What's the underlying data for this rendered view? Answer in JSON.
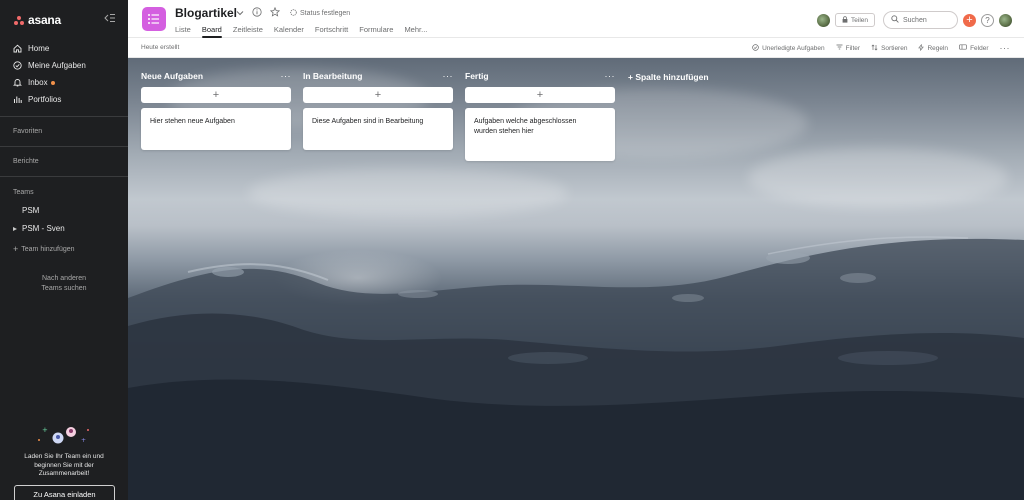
{
  "sidebar": {
    "logo_text": "asana",
    "nav": [
      {
        "label": "Home",
        "icon": "home-icon"
      },
      {
        "label": "Meine Aufgaben",
        "icon": "check-circle-icon"
      },
      {
        "label": "Inbox",
        "icon": "bell-icon"
      },
      {
        "label": "Portfolios",
        "icon": "bar-chart-icon"
      }
    ],
    "favorites_label": "Favoriten",
    "reports_label": "Berichte",
    "teams_label": "Teams",
    "teams": [
      {
        "label": "PSM"
      },
      {
        "label": "PSM - Sven"
      }
    ],
    "add_team_label": "Team hinzufügen",
    "browse_teams_label": "Nach anderen Teams suchen",
    "invite_text": "Laden Sie Ihr Team ein und beginnen Sie mit der Zusammenarbeit!",
    "invite_button": "Zu Asana einladen"
  },
  "header": {
    "project_title": "Blogartikel",
    "status_label": "Status festlegen",
    "tabs": [
      {
        "label": "Liste",
        "active": false
      },
      {
        "label": "Board",
        "active": true
      },
      {
        "label": "Zeitleiste",
        "active": false
      },
      {
        "label": "Kalender",
        "active": false
      },
      {
        "label": "Fortschritt",
        "active": false
      },
      {
        "label": "Formulare",
        "active": false
      },
      {
        "label": "Mehr...",
        "active": false
      }
    ],
    "share_label": "Teilen",
    "search_placeholder": "Suchen",
    "help_label": "?"
  },
  "toolbar": {
    "last_created": "Heute erstellt",
    "incomplete_tasks": "Unerledigte Aufgaben",
    "filter": "Filter",
    "sort": "Sortieren",
    "rules": "Regeln",
    "fields": "Felder"
  },
  "board": {
    "columns": [
      {
        "title": "Neue Aufgaben",
        "cards": [
          "Hier stehen neue Aufgaben"
        ]
      },
      {
        "title": "In Bearbeitung",
        "cards": [
          "Diese Aufgaben sind in Bearbeitung"
        ]
      },
      {
        "title": "Fertig",
        "cards": [
          "Aufgaben welche abgeschlossen wurden stehen hier"
        ]
      }
    ],
    "add_section_label": "+ Spalte hinzufügen",
    "add_card_symbol": "+",
    "more_symbol": "···"
  },
  "colors": {
    "sidebar_bg": "#1e1f21",
    "project_icon": "#d45fe0",
    "plus_button": "#f06a4a",
    "inbox_dot": "#f1914a",
    "logo": "#f06a6a"
  }
}
